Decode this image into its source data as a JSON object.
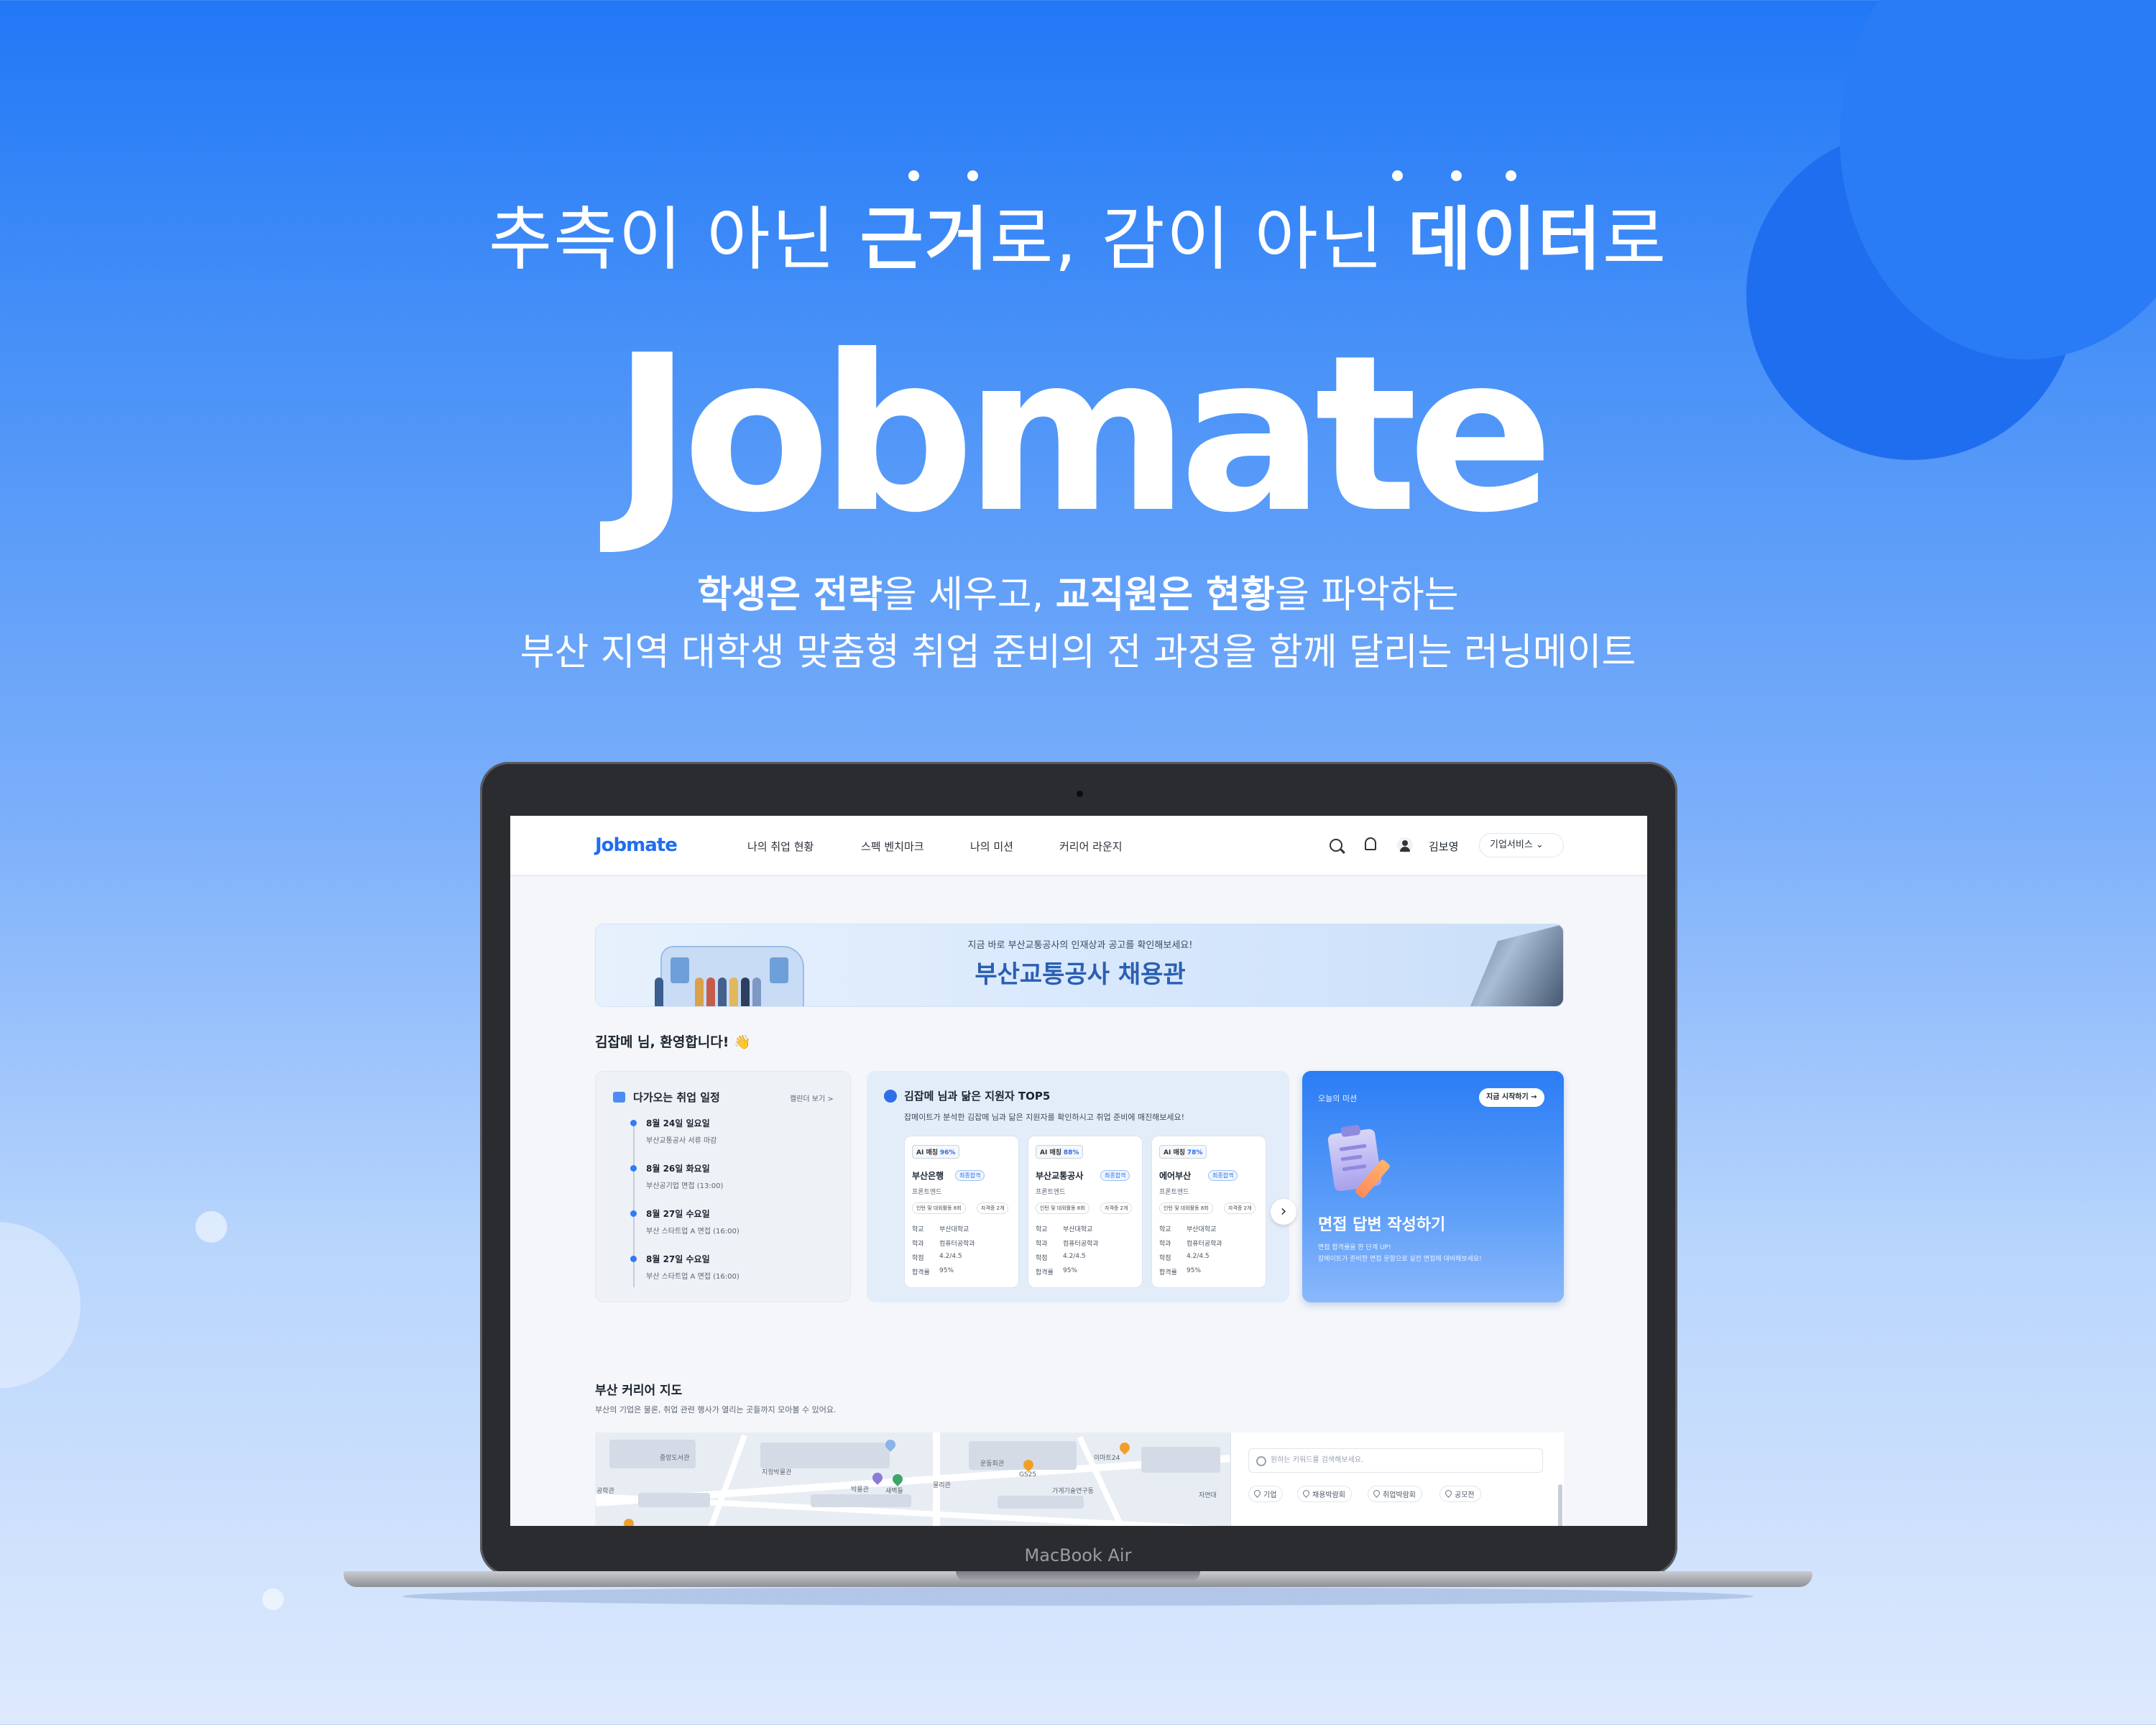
{
  "hero": {
    "tagline_a": "추측이 아닌 ",
    "tagline_b": "근거",
    "tagline_c": "로, 감이 아닌 ",
    "tagline_d": "데이터",
    "tagline_e": "로",
    "brand": "Jobmate",
    "sub1_a": "학생은 전략",
    "sub1_b": "을 세우고, ",
    "sub1_c": "교직원은 현황",
    "sub1_d": "을 파악하는",
    "sub2": "부산 지역 대학생 맞춤형 취업 준비의 전 과정을 함께 달리는 러닝메이트"
  },
  "device": {
    "label": "MacBook Air"
  },
  "app": {
    "logo": "Jobmate",
    "nav": [
      "나의 취업 현황",
      "스펙 벤치마크",
      "나의 미션",
      "커리어 라운지"
    ],
    "user_name": "김보영",
    "corp_button": "기업서비스 ⌄",
    "banner": {
      "small": "지금 바로 부산교통공사의 인재상과 공고를 확인해보세요!",
      "big": "부산교통공사 채용관"
    },
    "welcome": "김잡메 님, 환영합니다! 👋",
    "schedule": {
      "title": "다가오는 취업 일정",
      "more": "캘린더 보기 >",
      "items": [
        {
          "date": "8월 24일 일요일",
          "desc": "부산교통공사 서류 마감"
        },
        {
          "date": "8월 26일 화요일",
          "desc": "부산공기업 면접 (13:00)"
        },
        {
          "date": "8월 27일 수요일",
          "desc": "부산 스타트업 A 면접 (16:00)"
        },
        {
          "date": "8월 27일 수요일",
          "desc": "부산 스타트업 A 면접 (16:00)"
        }
      ]
    },
    "top5": {
      "title": "김잡메 님과 닮은 지원자 TOP5",
      "sub": "잡메이트가 분석한 김잡메 님과 닮은 지원자를 확인하시고 취업 준비에 매진해보세요!",
      "cards": [
        {
          "match": "96%",
          "company": "부산은행",
          "badge": "최종합격",
          "role": "프론트엔드",
          "chip1": "인턴 및 대외활동 8회",
          "chip2": "자격증 2개",
          "school": "부산대학교",
          "major": "컴퓨터공학과",
          "gpa": "4.2/4.5",
          "rate": "95%"
        },
        {
          "match": "88%",
          "company": "부산교통공사",
          "badge": "최종합격",
          "role": "프론트엔드",
          "chip1": "인턴 및 대외활동 8회",
          "chip2": "자격증 2개",
          "school": "부산대학교",
          "major": "컴퓨터공학과",
          "gpa": "4.2/4.5",
          "rate": "95%"
        },
        {
          "match": "78%",
          "company": "에어부산",
          "badge": "최종합격",
          "role": "프론트엔드",
          "chip1": "인턴 및 대외활동 8회",
          "chip2": "자격증 2개",
          "school": "부산대학교",
          "major": "컴퓨터공학과",
          "gpa": "4.2/4.5",
          "rate": "95%"
        }
      ],
      "labels": {
        "ai": "AI 매칭",
        "school": "학교",
        "major": "학과",
        "gpa": "학점",
        "rate": "합격률"
      }
    },
    "mission": {
      "small": "오늘의 미션",
      "button": "지금 시작하기 →",
      "title": "면접 답변 작성하기",
      "desc1": "면접 합격률을 한 단계 UP!",
      "desc2": "잡메이트가 준비한 면접 문항으로 실전 면접에 대비해보세요!"
    },
    "map": {
      "title": "부산 커리어 지도",
      "sub": "부산의 기업은 물론, 취업 관련 행사가 열리는 곳들까지 모아볼 수 있어요.",
      "search_placeholder": "원하는 키워드를 검색해보세요.",
      "chips": [
        "기업",
        "채용박람회",
        "취업박람회",
        "공모전"
      ],
      "labels": [
        "중앙도서관",
        "지정박물관",
        "박물관",
        "새벽들",
        "물리관",
        "운동회관",
        "이마트24",
        "가게기술연구동",
        "GS25",
        "자연대",
        "공학관"
      ]
    }
  },
  "colors": {
    "accent": "#2e7cf6",
    "brand_blue": "#1f6ef0",
    "bg_top": "#2178f6",
    "bg_bottom": "#dde9fd"
  }
}
